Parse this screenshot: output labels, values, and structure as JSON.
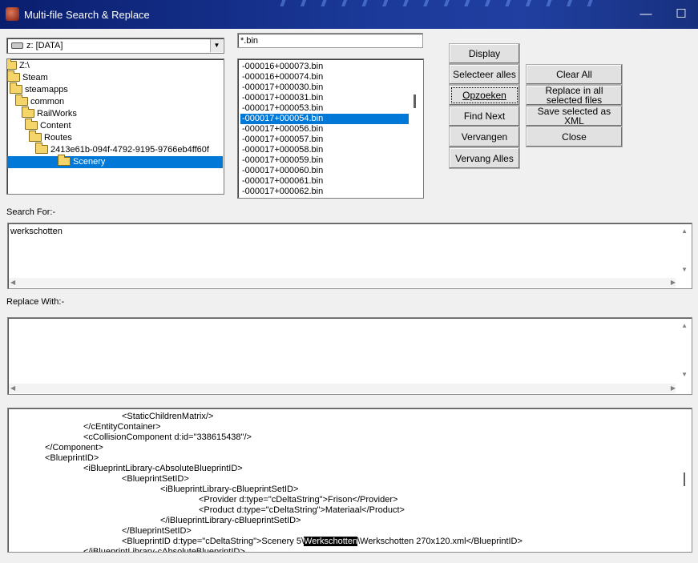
{
  "window": {
    "title": "Multi-file Search & Replace",
    "minimize_glyph": "—",
    "maximize_glyph": "☐"
  },
  "drive": {
    "selected": "z: [DATA]",
    "icon": "drive-icon"
  },
  "folders": {
    "items": [
      {
        "label": "Z:\\"
      },
      {
        "label": "Steam"
      },
      {
        "label": "steamapps"
      },
      {
        "label": "common"
      },
      {
        "label": "RailWorks"
      },
      {
        "label": "Content"
      },
      {
        "label": "Routes"
      },
      {
        "label": "2413e61b-094f-4792-9195-9766eb4ff60f"
      },
      {
        "label": "Scenery",
        "selected": true
      }
    ]
  },
  "file_filter": {
    "value": "*.bin"
  },
  "files": {
    "items": [
      "-000016+000073.bin",
      "-000016+000074.bin",
      "-000017+000030.bin",
      "-000017+000031.bin",
      "-000017+000053.bin",
      "-000017+000054.bin",
      "-000017+000056.bin",
      "-000017+000057.bin",
      "-000017+000058.bin",
      "-000017+000059.bin",
      "-000017+000060.bin",
      "-000017+000061.bin",
      "-000017+000062.bin"
    ],
    "selected_index": 5
  },
  "buttons": {
    "display": "Display",
    "select_all": "Selecteer alles",
    "search": "Opzoeken",
    "find_next": "Find Next",
    "replace": "Vervangen",
    "replace_all": "Vervang Alles",
    "clear_all": "Clear All",
    "replace_in_selected": "Replace in all selected files",
    "save_xml": "Save selected as XML",
    "close": "Close"
  },
  "search": {
    "label": "Search For:-",
    "value": "werkschotten"
  },
  "replace": {
    "label": "Replace With:-",
    "value": ""
  },
  "xml_preview": {
    "lines": [
      {
        "indent": 4,
        "text": "<StaticChildrenMatrix/>"
      },
      {
        "indent": 3,
        "text": "</cEntityContainer>"
      },
      {
        "indent": 3,
        "text": "<cCollisionComponent d:id=\"338615438\"/>"
      },
      {
        "indent": 2,
        "text": "</Component>"
      },
      {
        "indent": 2,
        "text": "<BlueprintID>"
      },
      {
        "indent": 3,
        "text": "<iBlueprintLibrary-cAbsoluteBlueprintID>"
      },
      {
        "indent": 4,
        "text": "<BlueprintSetID>"
      },
      {
        "indent": 5,
        "text": "<iBlueprintLibrary-cBlueprintSetID>"
      },
      {
        "indent": 6,
        "text": "<Provider d:type=\"cDeltaString\">Frison</Provider>"
      },
      {
        "indent": 6,
        "text": "<Product d:type=\"cDeltaString\">Materiaal</Product>"
      },
      {
        "indent": 5,
        "text": "</iBlueprintLibrary-cBlueprintSetID>"
      },
      {
        "indent": 4,
        "text": "</BlueprintSetID>"
      },
      {
        "indent": 4,
        "pre": "<BlueprintID d:type=\"cDeltaString\">Scenery 5\\",
        "highlight": "Werkschotten",
        "post": "\\Werkschotten 270x120.xml</BlueprintID>"
      },
      {
        "indent": 3,
        "text": "</iBlueprintLibrary-cAbsoluteBlueprintID>"
      }
    ]
  }
}
